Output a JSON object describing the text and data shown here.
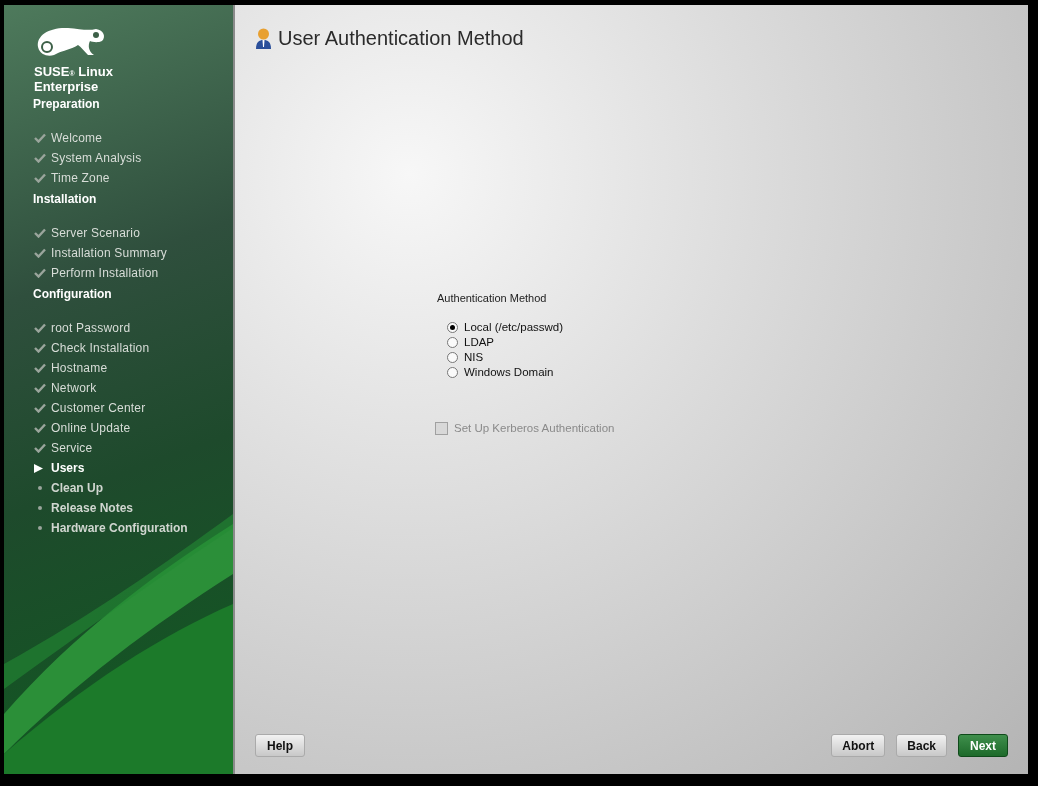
{
  "logo": {
    "brand": "SUSE",
    "mark": "®",
    "product": "Linux",
    "edition": "Enterprise"
  },
  "steps": [
    {
      "title": "Preparation",
      "items": [
        {
          "label": "Welcome",
          "kind": "done"
        },
        {
          "label": "System Analysis",
          "kind": "done"
        },
        {
          "label": "Time Zone",
          "kind": "done"
        }
      ]
    },
    {
      "title": "Installation",
      "items": [
        {
          "label": "Server Scenario",
          "kind": "done"
        },
        {
          "label": "Installation Summary",
          "kind": "done"
        },
        {
          "label": "Perform Installation",
          "kind": "done"
        }
      ]
    },
    {
      "title": "Configuration",
      "items": [
        {
          "label": "root Password",
          "kind": "done"
        },
        {
          "label": "Check Installation",
          "kind": "done"
        },
        {
          "label": "Hostname",
          "kind": "done"
        },
        {
          "label": "Network",
          "kind": "done"
        },
        {
          "label": "Customer Center",
          "kind": "done"
        },
        {
          "label": "Online Update",
          "kind": "done"
        },
        {
          "label": "Service",
          "kind": "done"
        },
        {
          "label": "Users",
          "kind": "current"
        },
        {
          "label": "Clean Up",
          "kind": "pending"
        },
        {
          "label": "Release Notes",
          "kind": "pending"
        },
        {
          "label": "Hardware Configuration",
          "kind": "pending"
        }
      ]
    }
  ],
  "page_title": "User Authentication Method",
  "method_group": {
    "label": "Authentication Method",
    "options": [
      {
        "label": "Local (/etc/passwd)",
        "selected": true
      },
      {
        "label": "LDAP",
        "selected": false
      },
      {
        "label": "NIS",
        "selected": false
      },
      {
        "label": "Windows Domain",
        "selected": false
      }
    ]
  },
  "kerberos": {
    "label": "Set Up Kerberos Authentication",
    "checked": false,
    "disabled": true
  },
  "buttons": [
    {
      "label": "Help",
      "kind": "plain"
    },
    {
      "label": "Abort",
      "kind": "plain"
    },
    {
      "label": "Back",
      "kind": "plain"
    },
    {
      "label": "Next",
      "kind": "primary"
    }
  ]
}
